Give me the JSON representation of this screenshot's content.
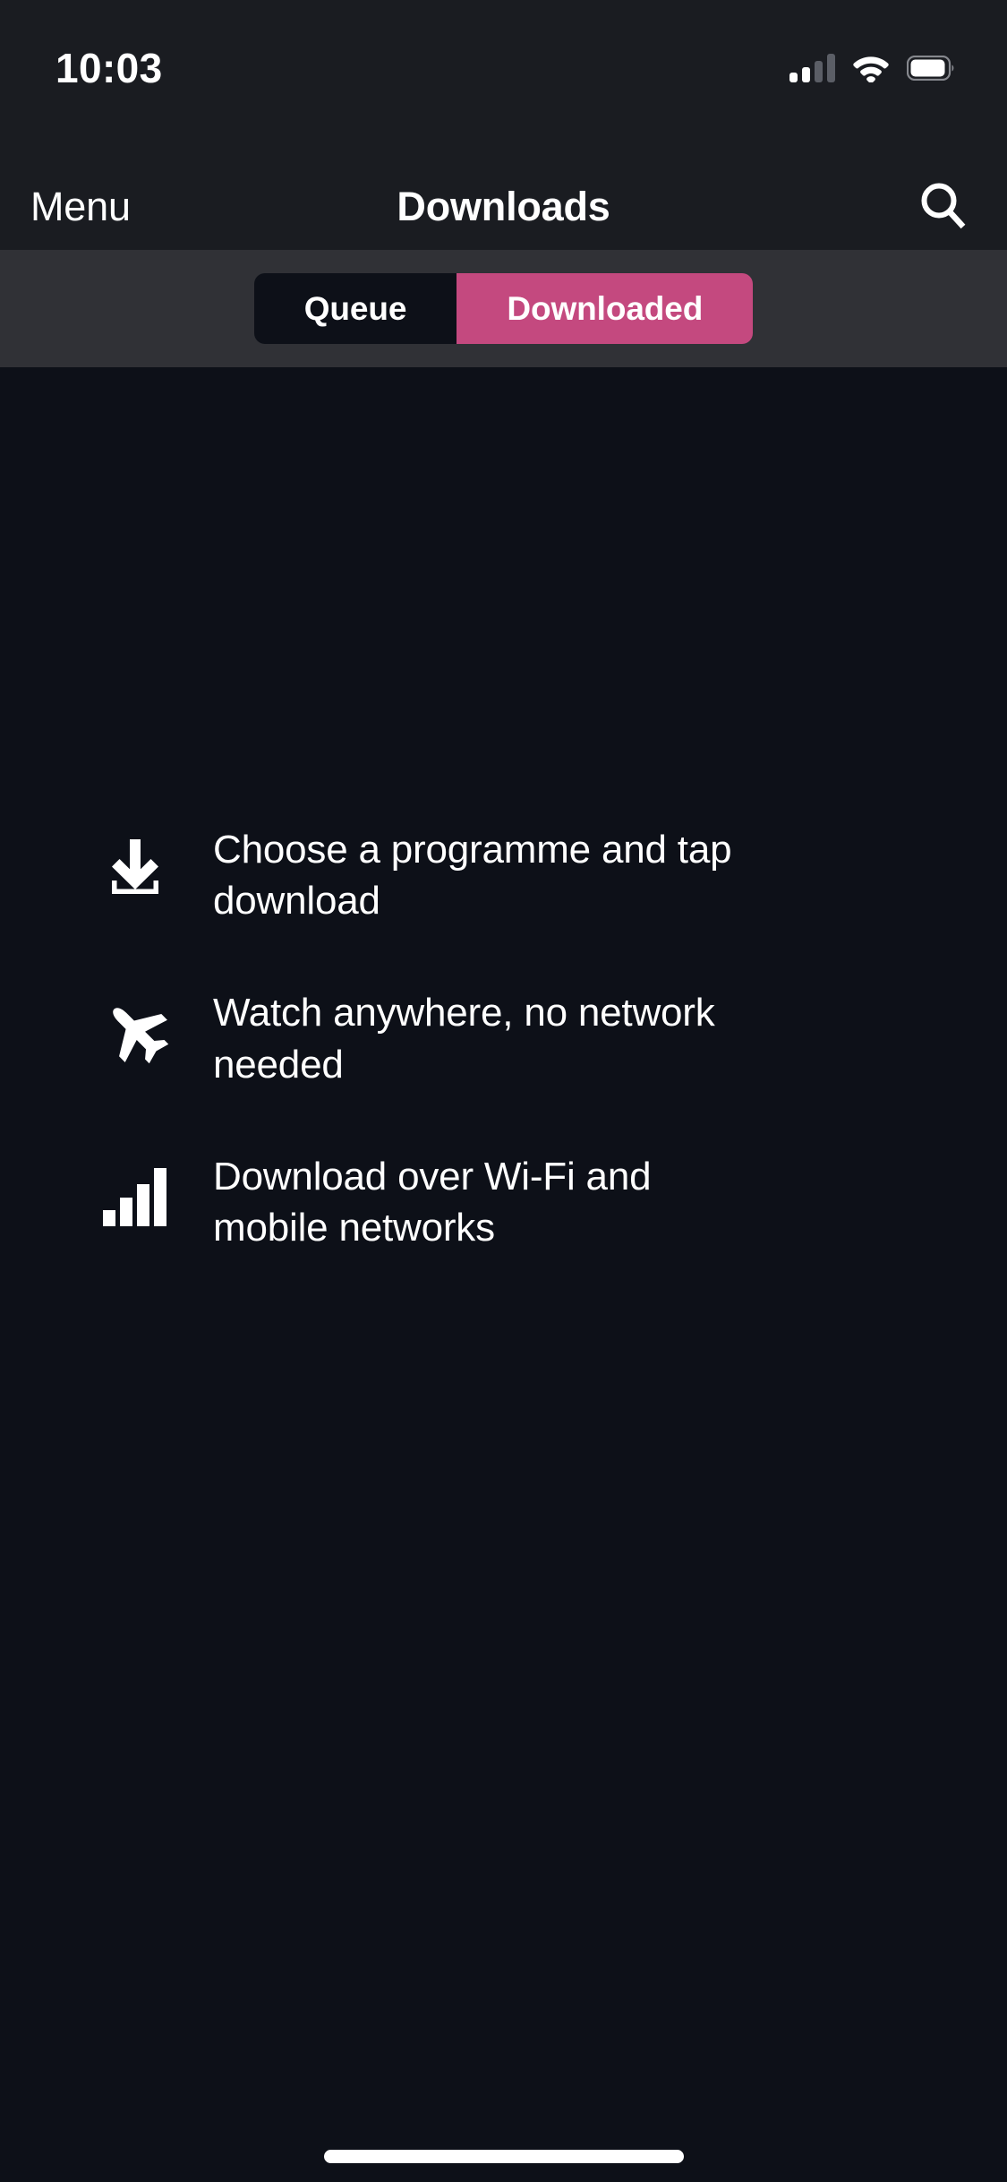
{
  "status_bar": {
    "time": "10:03",
    "cellular_icon": "cellular-signal-icon",
    "cellular_bars_filled": 2,
    "cellular_bars_total": 4,
    "wifi_icon": "wifi-icon",
    "battery_icon": "battery-icon",
    "battery_level_percent": 85,
    "background_color": "#1a1c21"
  },
  "nav_bar": {
    "menu_label": "Menu",
    "title": "Downloads",
    "search_icon": "search-icon",
    "background_color": "#1a1c21",
    "text_color": "#ffffff"
  },
  "tabs": {
    "background_color": "#303136",
    "active_color": "#c4497f",
    "inactive_color": "#0d1018",
    "items": [
      {
        "label": "Queue",
        "active": false
      },
      {
        "label": "Downloaded",
        "active": true
      }
    ]
  },
  "empty_state": {
    "background_color": "#0d1018",
    "features": [
      {
        "icon": "download-arrow-icon",
        "text": "Choose a programme and tap download"
      },
      {
        "icon": "airplane-icon",
        "text": "Watch anywhere, no network needed"
      },
      {
        "icon": "signal-bars-icon",
        "text": "Download over Wi-Fi and mobile networks"
      }
    ]
  },
  "home_indicator": {
    "name": "home-indicator",
    "color": "#ffffff"
  }
}
